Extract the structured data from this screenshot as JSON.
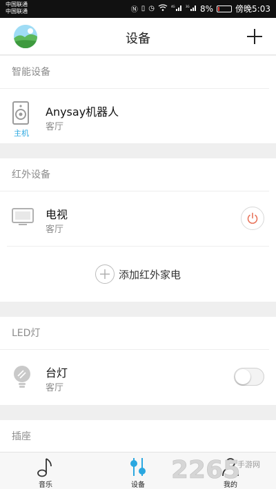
{
  "status_bar": {
    "carrier_1": "中国联通",
    "carrier_2": "中国联通",
    "battery_percent": "8%",
    "battery_level": 0.08,
    "time": "傍晚5:03",
    "signal_label_1": "4G",
    "signal_label_2": "3G"
  },
  "header": {
    "title": "设备",
    "add_icon": "plus-icon"
  },
  "sections": [
    {
      "title": "智能设备",
      "device": {
        "name": "Anysay机器人",
        "room": "客厅",
        "badge": "主机",
        "icon": "speaker-icon"
      }
    },
    {
      "title": "红外设备",
      "device": {
        "name": "电视",
        "room": "客厅",
        "icon": "tv-icon",
        "action_icon": "power-icon"
      },
      "add_label": "添加红外家电"
    },
    {
      "title": "LED灯",
      "device": {
        "name": "台灯",
        "room": "客厅",
        "icon": "bulb-icon",
        "switch_on": false
      }
    },
    {
      "title": "插座"
    }
  ],
  "bottom_nav": [
    {
      "label": "音乐",
      "icon": "music-note-icon",
      "active": false
    },
    {
      "label": "设备",
      "icon": "sliders-icon",
      "active": true
    },
    {
      "label": "我的",
      "icon": "user-icon",
      "active": false
    }
  ],
  "watermark": {
    "text": "2265",
    "sub": "手游网"
  },
  "colors": {
    "accent": "#2aa7e0",
    "power": "#e8735a",
    "background": "#efefef"
  }
}
